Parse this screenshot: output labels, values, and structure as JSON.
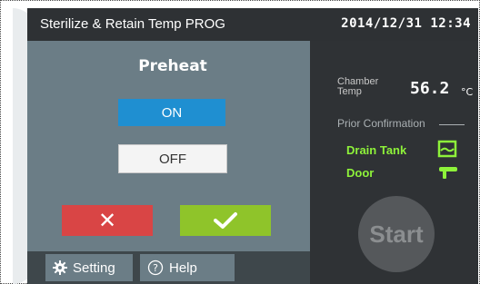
{
  "header": {
    "title": "Sterilize & Retain Temp PROG",
    "datetime": "2014/12/31 12:34"
  },
  "preheat": {
    "title": "Preheat",
    "on_label": "ON",
    "off_label": "OFF",
    "selected": "ON"
  },
  "actions": {
    "cancel_symbol": "✕",
    "confirm_icon": "check-icon"
  },
  "footer": {
    "setting_label": "Setting",
    "help_label": "Help"
  },
  "status": {
    "chamber_label_line1": "Chamber",
    "chamber_label_line2": "Temp",
    "chamber_value": "56.2",
    "chamber_unit": "°C",
    "prior_label": "Prior Confirmation",
    "items": [
      {
        "label": "Drain Tank",
        "icon": "drain-tank-icon"
      },
      {
        "label": "Door",
        "icon": "door-key-icon"
      }
    ],
    "start_label": "Start"
  },
  "colors": {
    "header_bg": "#2e3134",
    "panel_bg": "#6b7d86",
    "status_bg": "#2f3235",
    "on_blue": "#1f8fd1",
    "cancel_red": "#d94545",
    "confirm_green": "#8fc42a",
    "ok_text_green": "#8ef23a"
  }
}
